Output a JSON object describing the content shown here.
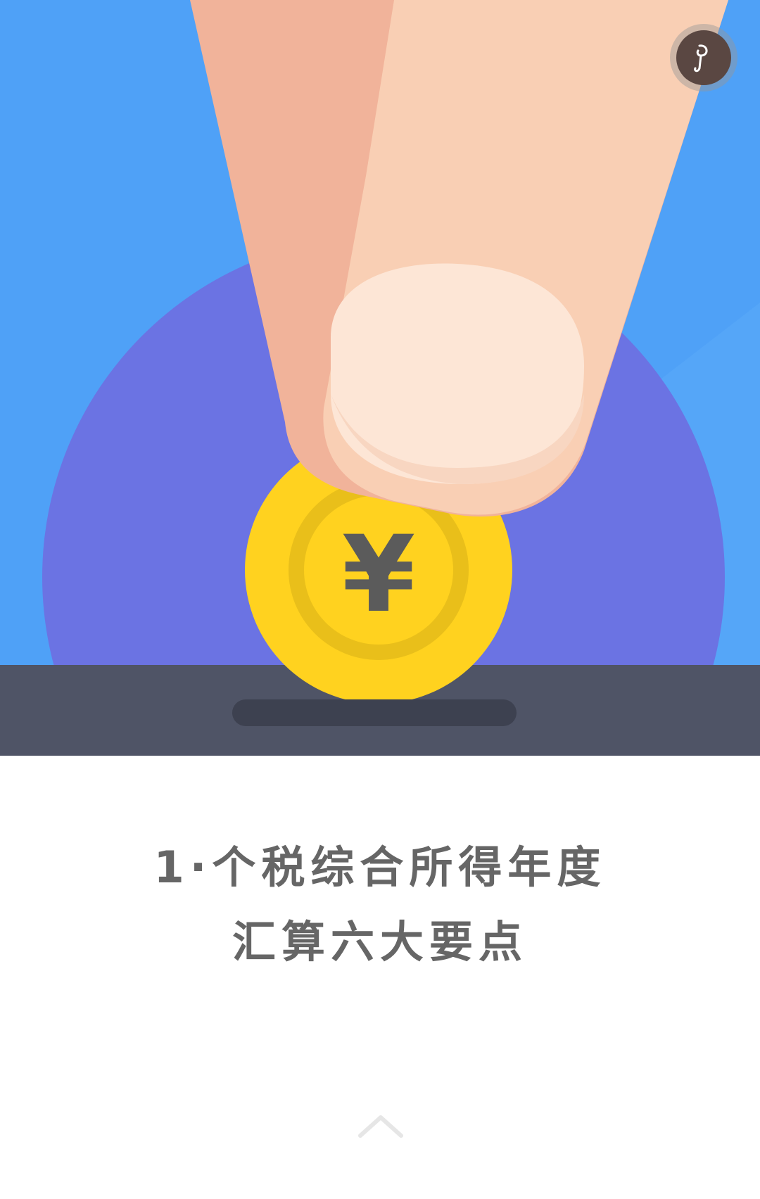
{
  "hero": {
    "coin_symbol": "¥",
    "colors": {
      "background_blue": "#4fa1f7",
      "circle_purple": "#6b73e3",
      "slot_bar": "#4f5466",
      "slot_hole": "#3d4150",
      "coin_outer": "#ffd21f",
      "coin_ring": "#e9bf1a",
      "coin_symbol": "#5b5b5b",
      "finger": "#f9cfb4",
      "finger_shadow": "#f1b39a",
      "nail": "#fde6d6"
    }
  },
  "music_button": {
    "icon": "music-note-icon"
  },
  "title": {
    "line1": "1·个税综合所得年度",
    "line2": "汇算六大要点",
    "color": "#666666"
  },
  "scroll_hint": {
    "icon": "chevron-up-icon"
  }
}
